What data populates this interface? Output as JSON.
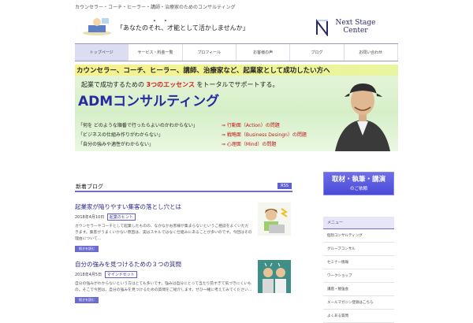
{
  "topline": "カウンセラー・コーチ・ヒーラー・講師・治療家のためのコンサルティング",
  "header": {
    "catch_dots": "・・",
    "catch": "「あなたのそれ、才能として活かしませんか」",
    "logo_line1": "Next Stage",
    "logo_line2": "Center"
  },
  "nav": {
    "items": [
      "トップページ",
      "サービス・料金一覧",
      "プロフィール",
      "お客様の声",
      "ブログ",
      "お問い合わせ"
    ]
  },
  "banner": {
    "line1": "カウンセラー、コーチ、ヒーラー、講師、治療家など、起業家として成功したい方へ",
    "line2_a": "起業で成功するための",
    "line2_b": "3つのエッセンス",
    "line2_c": "をトータルでサポートする。",
    "title": "ADMコンサルティング",
    "questions": [
      "「何を どのような順番で行ったらよいのかわからない」",
      "「ビジネスの仕組み作りがわからない」",
      "「自分の強みや適性がわからない」"
    ],
    "answers": [
      "⇒ 行動面（Action）の問題",
      "⇒ 戦略面（Business Desingn）の問題",
      "⇒ 心理面（Mind）の問題"
    ]
  },
  "section": {
    "title": "新着ブログ",
    "rss": "RSS"
  },
  "posts": [
    {
      "title": "起業家が陥りやすい集客の落とし穴とは",
      "date": "2018年4月10日",
      "category": "起業のヒント",
      "excerpt": "カウンセラーやコーチとして起業したものの、なかなかお客様が集まらないというご相談をよくいただきます。集客がうまくいかない原因は、実はスキルではなく仕組みにあることが多いのです。今回はその理由について…",
      "readmore": "続きを読む"
    },
    {
      "title": "自分の強みを見つけるための３つの質問",
      "date": "2018年4月5日",
      "category": "マインドセット",
      "excerpt": "自分の強みがわからないという方はとても多いです。強みは自分にとって当たり前すぎて気づきにくいもの。そこで今回は、自分の強みを見つけるための質問をご紹介します。ぜひ一緒に考えてみてください…",
      "readmore": "続きを読む"
    }
  ],
  "sidebar": {
    "banner_line1": "取材・執筆・講演",
    "banner_line2": "のご依頼",
    "menu_head": "メニュー",
    "menu_items": [
      "個別コンサルティング",
      "グループコンサル",
      "セミナー情報",
      "ワークショップ",
      "講座・勉強会",
      "メールマガジン登録はこちら",
      "よくある質問"
    ]
  },
  "colors": {
    "accent": "#6b6bd0",
    "nav_active": "#dcdcf2",
    "banner_title": "#2a2aa0",
    "banner_answer": "#c01818"
  }
}
